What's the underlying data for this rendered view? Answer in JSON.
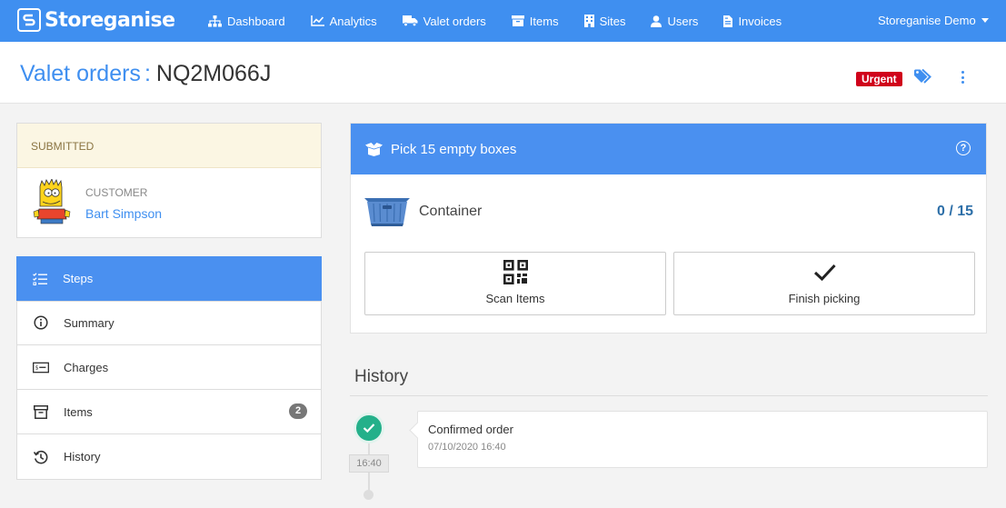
{
  "app": {
    "brand": "Storeganise",
    "nav": [
      {
        "label": "Dashboard",
        "icon": "sitemap-icon"
      },
      {
        "label": "Analytics",
        "icon": "line-chart-icon"
      },
      {
        "label": "Valet orders",
        "icon": "truck-icon"
      },
      {
        "label": "Items",
        "icon": "archive-icon"
      },
      {
        "label": "Sites",
        "icon": "building-icon"
      },
      {
        "label": "Users",
        "icon": "user-icon"
      },
      {
        "label": "Invoices",
        "icon": "file-invoice-icon"
      }
    ],
    "account": "Storeganise Demo"
  },
  "header": {
    "crumb": "Valet orders",
    "separator": ":",
    "order_code": "NQ2M066J",
    "badge": "Urgent"
  },
  "status": {
    "state": "SUBMITTED",
    "customer_label": "CUSTOMER",
    "customer_name": "Bart Simpson"
  },
  "sidemenu": {
    "items": [
      {
        "label": "Steps",
        "icon": "checklist-icon",
        "active": true
      },
      {
        "label": "Summary",
        "icon": "info-icon"
      },
      {
        "label": "Charges",
        "icon": "money-bill-icon"
      },
      {
        "label": "Items",
        "icon": "archive-icon",
        "badge": "2"
      },
      {
        "label": "History",
        "icon": "history-icon"
      }
    ]
  },
  "task": {
    "title": "Pick 15 empty boxes",
    "item_label": "Container",
    "progress_text": "0 / 15",
    "scan_label": "Scan Items",
    "finish_label": "Finish picking"
  },
  "history": {
    "title": "History",
    "events": [
      {
        "time": "16:40",
        "title": "Confirmed order",
        "date": "07/10/2020 16:40"
      }
    ]
  },
  "colors": {
    "primary": "#3f8ff0",
    "urgent": "#d0021b",
    "success": "#24b08a",
    "submitted_bg": "#fbf6e3"
  }
}
